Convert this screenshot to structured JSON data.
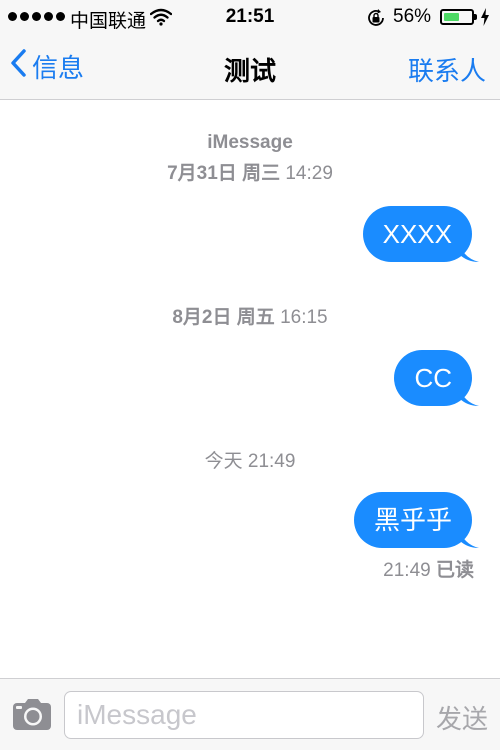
{
  "status_bar": {
    "carrier": "中国联通",
    "time": "21:51",
    "battery_percent": "56%",
    "battery_level": 0.56,
    "icons": [
      "signal-dots",
      "wifi-icon",
      "rotation-lock-icon",
      "battery-icon",
      "charging-icon"
    ]
  },
  "nav": {
    "back_label": "信息",
    "title": "测试",
    "contact_label": "联系人"
  },
  "conversation": {
    "service": "iMessage",
    "timestamps": [
      {
        "date": "7月31日",
        "weekday": "周三",
        "time": "14:29"
      },
      {
        "date": "8月2日",
        "weekday": "周五",
        "time": "16:15"
      },
      {
        "date": "今天",
        "weekday": "",
        "time": "21:49"
      }
    ],
    "messages": [
      {
        "text": "XXXX",
        "direction": "outgoing"
      },
      {
        "text": "CC",
        "direction": "outgoing"
      },
      {
        "text": "黑乎乎",
        "direction": "outgoing"
      }
    ],
    "read_receipt": {
      "time": "21:49",
      "status": "已读"
    }
  },
  "input_bar": {
    "placeholder": "iMessage",
    "value": "",
    "send_label": "发送"
  },
  "colors": {
    "accent": "#1a7cf0",
    "bubble": "#1a8cff",
    "meta_text": "#8e8e93",
    "battery": "#4cd964"
  }
}
